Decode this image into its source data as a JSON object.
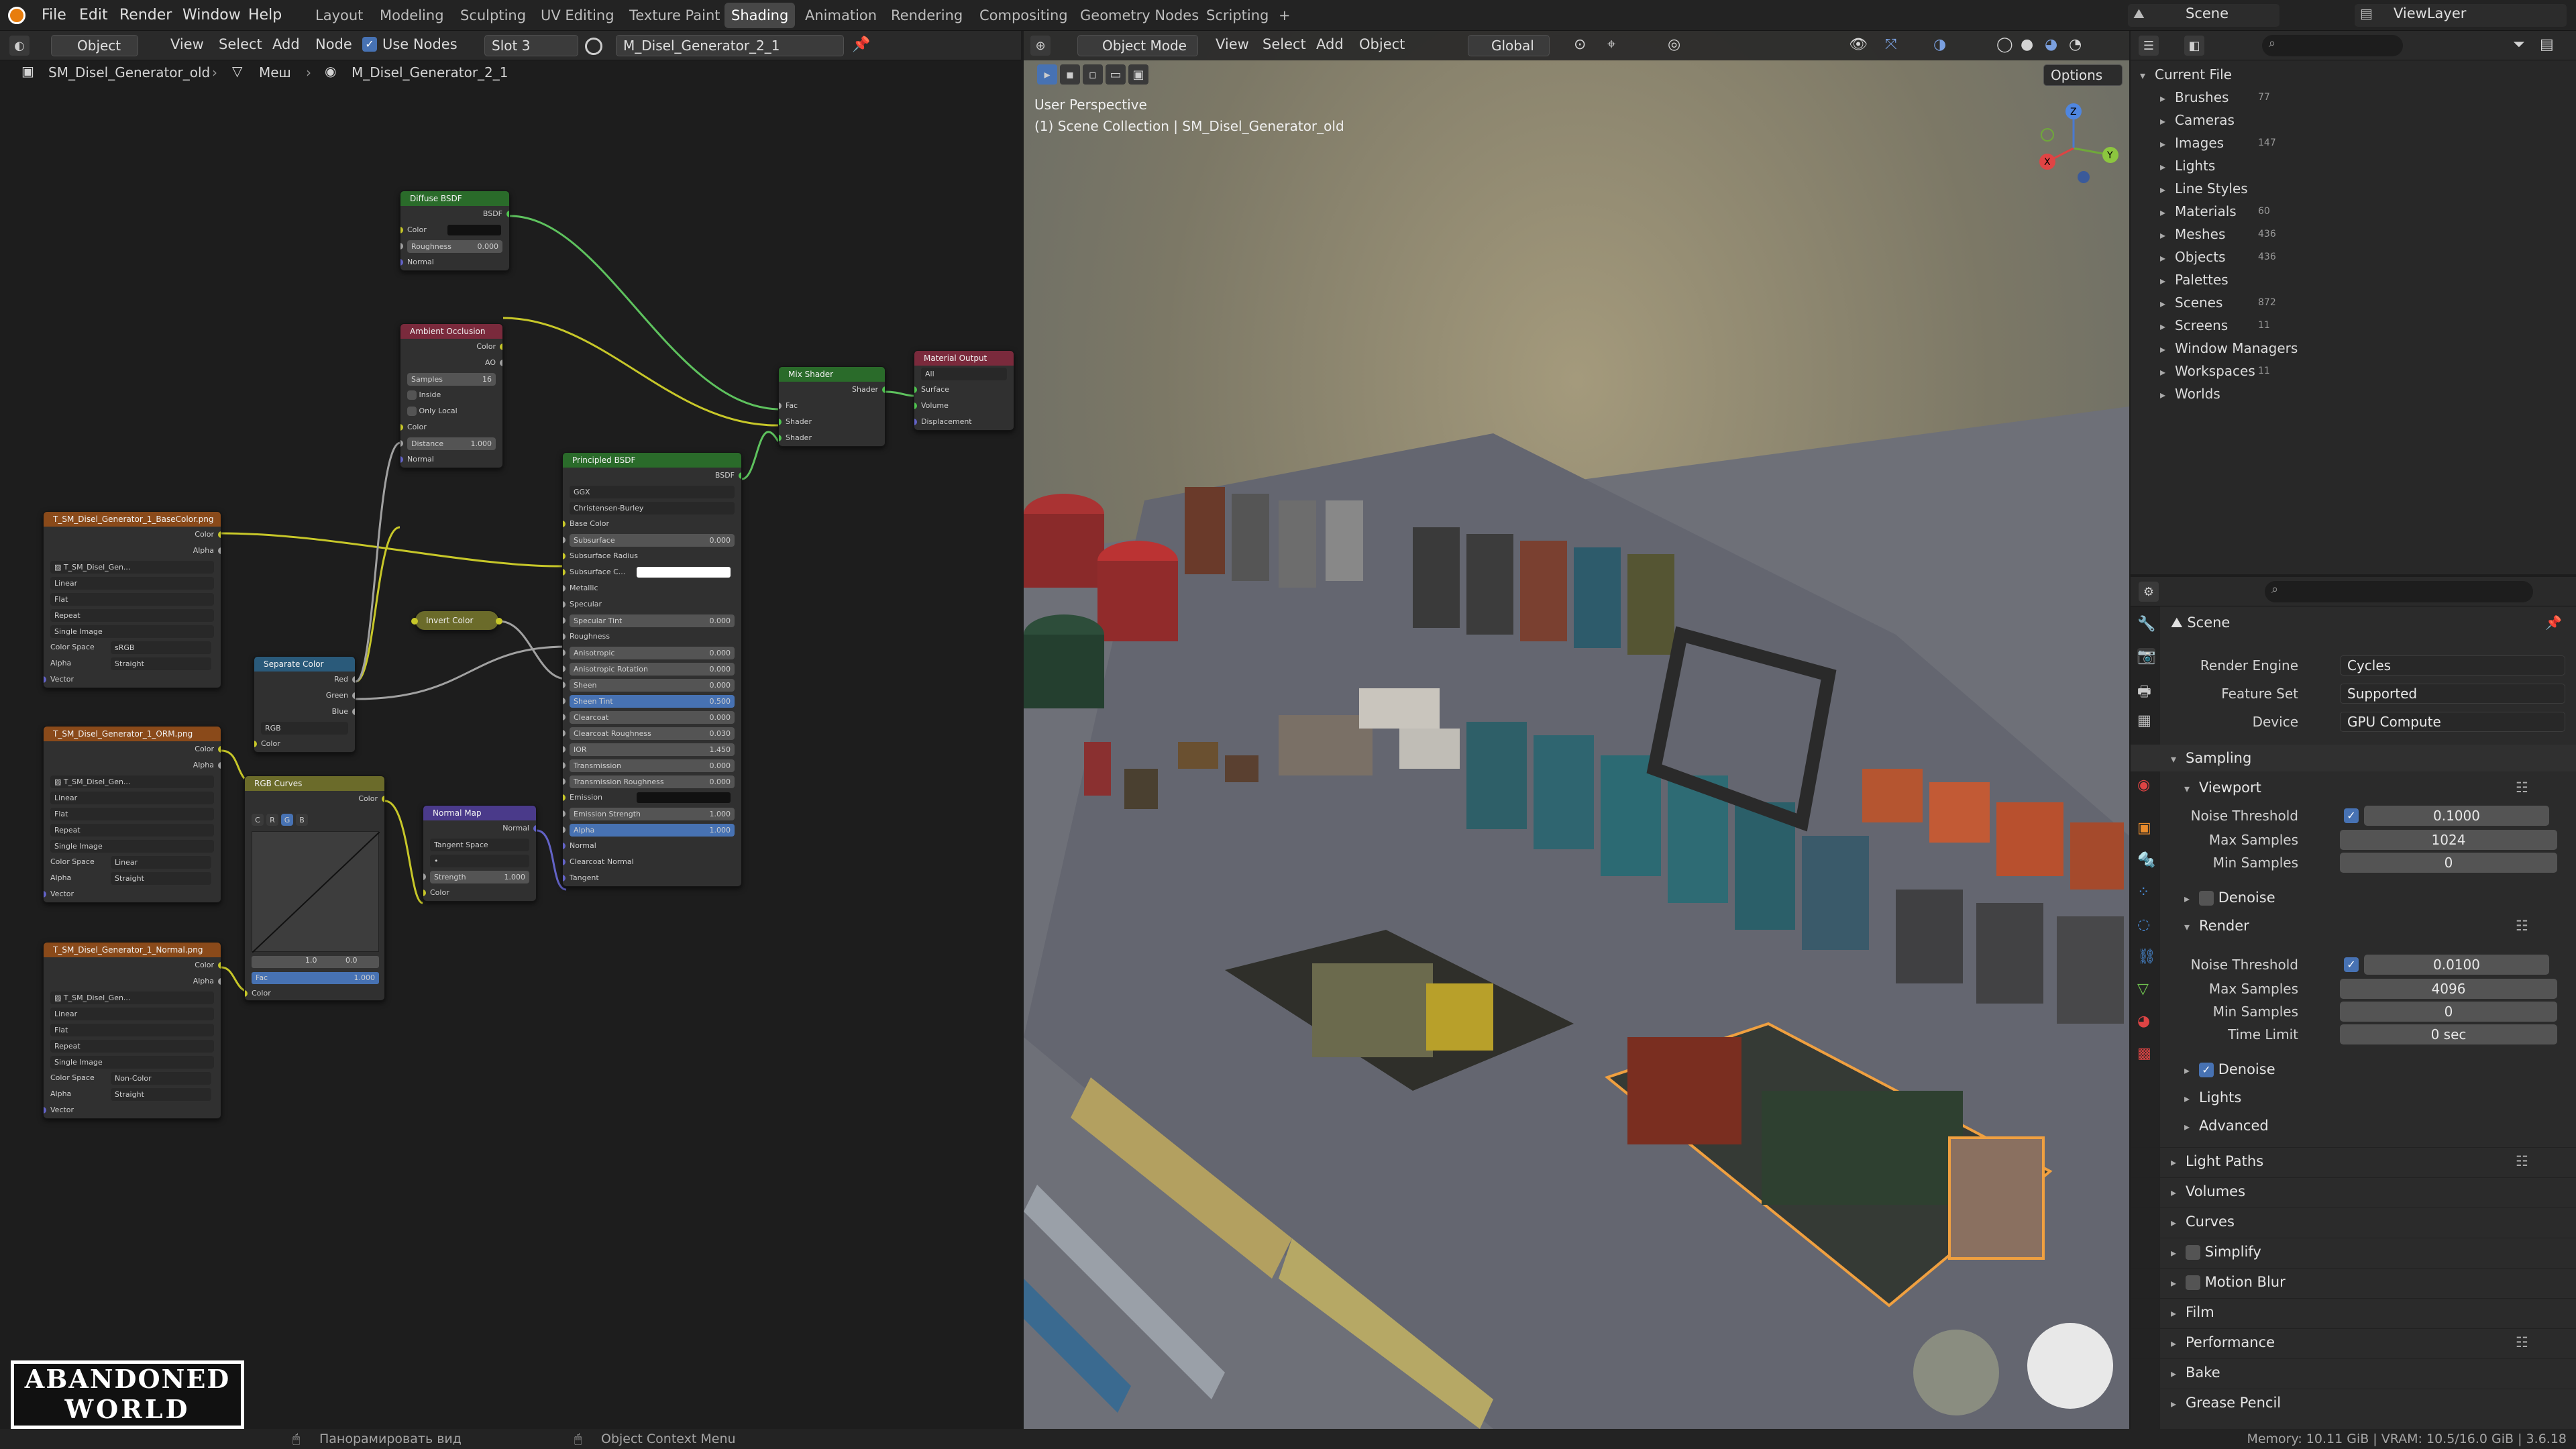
{
  "menus": [
    "File",
    "Edit",
    "Render",
    "Window",
    "Help"
  ],
  "workspaces": [
    "Layout",
    "Modeling",
    "Sculpting",
    "UV Editing",
    "Texture Paint",
    "Shading",
    "Animation",
    "Rendering",
    "Compositing",
    "Geometry Nodes",
    "Scripting",
    "+"
  ],
  "active_workspace_index": 5,
  "top_right": {
    "scene": "Scene",
    "view_layer": "ViewLayer"
  },
  "node_header": {
    "object_mode": "Object",
    "view": "View",
    "select": "Select",
    "add": "Add",
    "node": "Node",
    "use_nodes": "Use Nodes",
    "slot": "Slot 3",
    "material": "M_Disel_Generator_2_1"
  },
  "breadcrumb": {
    "object": "SM_Disel_Generator_old",
    "mesh": "Меш",
    "material": "M_Disel_Generator_2_1"
  },
  "nodes": {
    "diffuse": {
      "title": "Diffuse BSDF",
      "out": "BSDF",
      "color": "Color",
      "roughness": "Roughness",
      "roughness_val": "0.000",
      "normal": "Normal"
    },
    "ao": {
      "title": "Ambient Occlusion",
      "out_color": "Color",
      "out_ao": "AO",
      "samples": "Samples",
      "samples_val": "16",
      "inside": "Inside",
      "only_local": "Only Local",
      "color": "Color",
      "distance": "Distance",
      "distance_val": "1.000",
      "normal": "Normal"
    },
    "mix": {
      "title": "Mix Shader",
      "out": "Shader",
      "fac": "Fac",
      "shader1": "Shader",
      "shader2": "Shader"
    },
    "output": {
      "title": "Material Output",
      "target": "All",
      "surface": "Surface",
      "volume": "Volume",
      "displacement": "Displacement"
    },
    "principled": {
      "title": "Principled BSDF",
      "out": "BSDF",
      "dist": "GGX",
      "sss_method": "Christensen-Burley",
      "rows": [
        {
          "label": "Base Color",
          "val": ""
        },
        {
          "label": "Subsurface",
          "val": "0.000"
        },
        {
          "label": "Subsurface Radius",
          "val": ""
        },
        {
          "label": "Subsurface C...",
          "val": ""
        },
        {
          "label": "Metallic",
          "val": ""
        },
        {
          "label": "Specular",
          "val": ""
        },
        {
          "label": "Specular Tint",
          "val": "0.000"
        },
        {
          "label": "Roughness",
          "val": ""
        },
        {
          "label": "Anisotropic",
          "val": "0.000"
        },
        {
          "label": "Anisotropic Rotation",
          "val": "0.000"
        },
        {
          "label": "Sheen",
          "val": "0.000"
        },
        {
          "label": "Sheen Tint",
          "val": "0.500"
        },
        {
          "label": "Clearcoat",
          "val": "0.000"
        },
        {
          "label": "Clearcoat Roughness",
          "val": "0.030"
        },
        {
          "label": "IOR",
          "val": "1.450"
        },
        {
          "label": "Transmission",
          "val": "0.000"
        },
        {
          "label": "Transmission Roughness",
          "val": "0.000"
        },
        {
          "label": "Emission",
          "val": ""
        },
        {
          "label": "Emission Strength",
          "val": "1.000"
        },
        {
          "label": "Alpha",
          "val": "1.000"
        },
        {
          "label": "Normal",
          "val": ""
        },
        {
          "label": "Clearcoat Normal",
          "val": ""
        },
        {
          "label": "Tangent",
          "val": ""
        }
      ]
    },
    "invert": {
      "title": "Invert Color"
    },
    "separate": {
      "title": "Separate Color",
      "red": "Red",
      "green": "Green",
      "blue": "Blue",
      "mode": "RGB",
      "color": "Color"
    },
    "curves": {
      "title": "RGB Curves",
      "out": "Color",
      "fac": "Fac",
      "fac_val": "1.000",
      "color": "Color",
      "channels": [
        "C",
        "R",
        "G",
        "B"
      ],
      "val1": "1.0",
      "val2": "0.0"
    },
    "normalmap": {
      "title": "Normal Map",
      "out": "Normal",
      "space": "Tangent Space",
      "strength": "Strength",
      "strength_val": "1.000",
      "color": "Color"
    },
    "tex1": {
      "title": "T_SM_Disel_Generator_1_BaseColor.png",
      "out_color": "Color",
      "out_alpha": "Alpha",
      "image": "T_SM_Disel_Gen...",
      "interp": "Linear",
      "proj": "Flat",
      "ext": "Repeat",
      "source": "Single Image",
      "cs_label": "Color Space",
      "cs": "sRGB",
      "alpha_label": "Alpha",
      "alpha": "Straight",
      "vector": "Vector"
    },
    "tex2": {
      "title": "T_SM_Disel_Generator_1_ORM.png",
      "out_color": "Color",
      "out_alpha": "Alpha",
      "image": "T_SM_Disel_Gen...",
      "interp": "Linear",
      "proj": "Flat",
      "ext": "Repeat",
      "source": "Single Image",
      "cs_label": "Color Space",
      "cs": "Linear",
      "alpha_label": "Alpha",
      "alpha": "Straight",
      "vector": "Vector"
    },
    "tex3": {
      "title": "T_SM_Disel_Generator_1_Normal.png",
      "out_color": "Color",
      "out_alpha": "Alpha",
      "image": "T_SM_Disel_Gen...",
      "interp": "Linear",
      "proj": "Flat",
      "ext": "Repeat",
      "source": "Single Image",
      "cs_label": "Color Space",
      "cs": "Non-Color",
      "alpha_label": "Alpha",
      "alpha": "Straight",
      "vector": "Vector"
    }
  },
  "viewport": {
    "mode": "Object Mode",
    "view": "View",
    "select": "Select",
    "add": "Add",
    "object": "Object",
    "orientation": "Global",
    "options": "Options",
    "perspective": "User Perspective",
    "collection": "(1) Scene Collection | SM_Disel_Generator_old"
  },
  "outliner": {
    "root": "Current File",
    "items": [
      {
        "label": "Brushes",
        "count": "77"
      },
      {
        "label": "Cameras",
        "count": ""
      },
      {
        "label": "Images",
        "count": "147"
      },
      {
        "label": "Lights",
        "count": ""
      },
      {
        "label": "Line Styles",
        "count": ""
      },
      {
        "label": "Materials",
        "count": "60"
      },
      {
        "label": "Meshes",
        "count": "436"
      },
      {
        "label": "Objects",
        "count": "436"
      },
      {
        "label": "Palettes",
        "count": ""
      },
      {
        "label": "Scenes",
        "count": "872"
      },
      {
        "label": "Screens",
        "count": "11"
      },
      {
        "label": "Window Managers",
        "count": ""
      },
      {
        "label": "Workspaces",
        "count": "11"
      },
      {
        "label": "Worlds",
        "count": ""
      }
    ]
  },
  "properties": {
    "title": "Scene",
    "render_engine_label": "Render Engine",
    "render_engine": "Cycles",
    "feature_set_label": "Feature Set",
    "feature_set": "Supported",
    "device_label": "Device",
    "device": "GPU Compute",
    "sampling": "Sampling",
    "viewport": "Viewport",
    "render": "Render",
    "noise_threshold": "Noise Threshold",
    "max_samples": "Max Samples",
    "min_samples": "Min Samples",
    "time_limit": "Time Limit",
    "denoise": "Denoise",
    "vp_noise": "0.1000",
    "vp_max": "1024",
    "vp_min": "0",
    "r_noise": "0.0100",
    "r_max": "4096",
    "r_min": "0",
    "r_time": "0 sec",
    "sub": [
      "Lights",
      "Advanced"
    ],
    "panels": [
      "Light Paths",
      "Volumes",
      "Curves",
      "Simplify",
      "Motion Blur",
      "Film",
      "Performance",
      "Bake",
      "Grease Pencil"
    ]
  },
  "status": {
    "pan": "Панорамировать вид",
    "context": "Object Context Menu",
    "memory": "Memory: 10.11 GiB | VRAM: 10.5/16.0 GiB | 3.6.18"
  },
  "watermark": {
    "line1": "ABANDONED",
    "line2": "WORLD"
  }
}
